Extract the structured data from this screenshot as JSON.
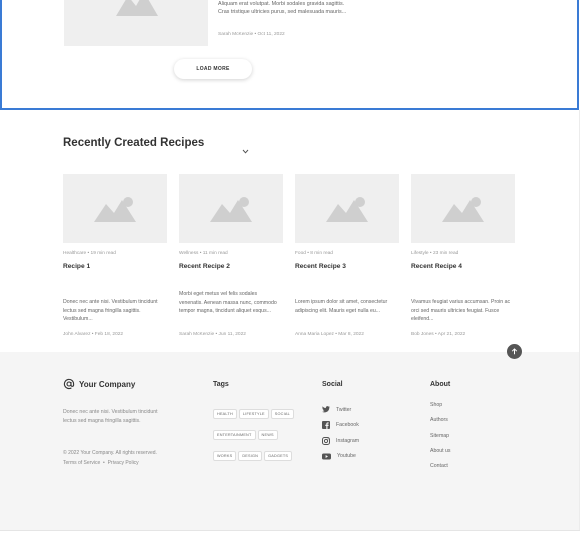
{
  "top_post": {
    "excerpt": "Aliquam erat volutpat. Morbi sodales gravida sagittis. Cras tristique ultricies purus, sed malesuada mauris...",
    "meta": "Sarah McKenzie • Oct 11, 2022"
  },
  "load_more_label": "LOAD MORE",
  "recipes_section": {
    "title": "Recently Created Recipes",
    "cards": [
      {
        "meta": "Healthcare • 19 min read",
        "title": "Recipe 1",
        "excerpt": "Donec nec ante nisi. Vestibulum tincidunt lectus sed magna fringilla sagittis. Vestibulum...",
        "author": "John Alvarez • Feb 18, 2022"
      },
      {
        "meta": "Wellness • 11 min read",
        "title": "Recent Recipe 2",
        "excerpt": "Morbi eget metus vel felis sodales venenatis. Aenean massa nunc, commodo tempor magna, tincidunt aliquet esqus...",
        "author": "Sarah McKenzie • Jun 11, 2022"
      },
      {
        "meta": "Food • 8 min read",
        "title": "Recent Recipe 3",
        "excerpt": "Lorem ipsum dolor sit amet, consectetur adipiscing elit. Mauris eget nulla eu...",
        "author": "Anna Maria Lopez • Mar 8, 2022"
      },
      {
        "meta": "Lifestyle • 23 min read",
        "title": "Recent Recipe 4",
        "excerpt": "Vivamus feugiat varius accumsan. Proin ac orci sed mauris ultricies feugiat. Fusce eleifend...",
        "author": "Bob Jones • Apr 21, 2022"
      }
    ]
  },
  "footer": {
    "brand_name": "Your Company",
    "description": "Donec nec ante nisi. Vestibulum tincidunt lectus sed magna fringilla sagittis.",
    "copyright": "© 2022 Your Company.  All rights reserved.",
    "terms": "Terms of Service",
    "separator": "•",
    "privacy": "Privacy Policy",
    "tags_heading": "Tags",
    "tags": [
      "HEALTH",
      "LIFESTYLE",
      "SOCIAL",
      "ENTERTAINMENT",
      "NEWS",
      "WORKS",
      "DESIGN",
      "GADGETS"
    ],
    "social_heading": "Social",
    "social": [
      {
        "label": "Twitter",
        "icon": "twitter-icon"
      },
      {
        "label": "Facebook",
        "icon": "facebook-icon"
      },
      {
        "label": "Instagram",
        "icon": "instagram-icon"
      },
      {
        "label": "Youtube",
        "icon": "youtube-icon"
      }
    ],
    "about_heading": "About",
    "about": [
      "Shop",
      "Authors",
      "Sitemap",
      "About us",
      "Contact"
    ]
  },
  "colors": {
    "selection_border": "#3a7bd5",
    "placeholder_bg": "#efefef",
    "placeholder_icon": "#cfcfcf",
    "footer_bg": "#f5f5f5"
  }
}
